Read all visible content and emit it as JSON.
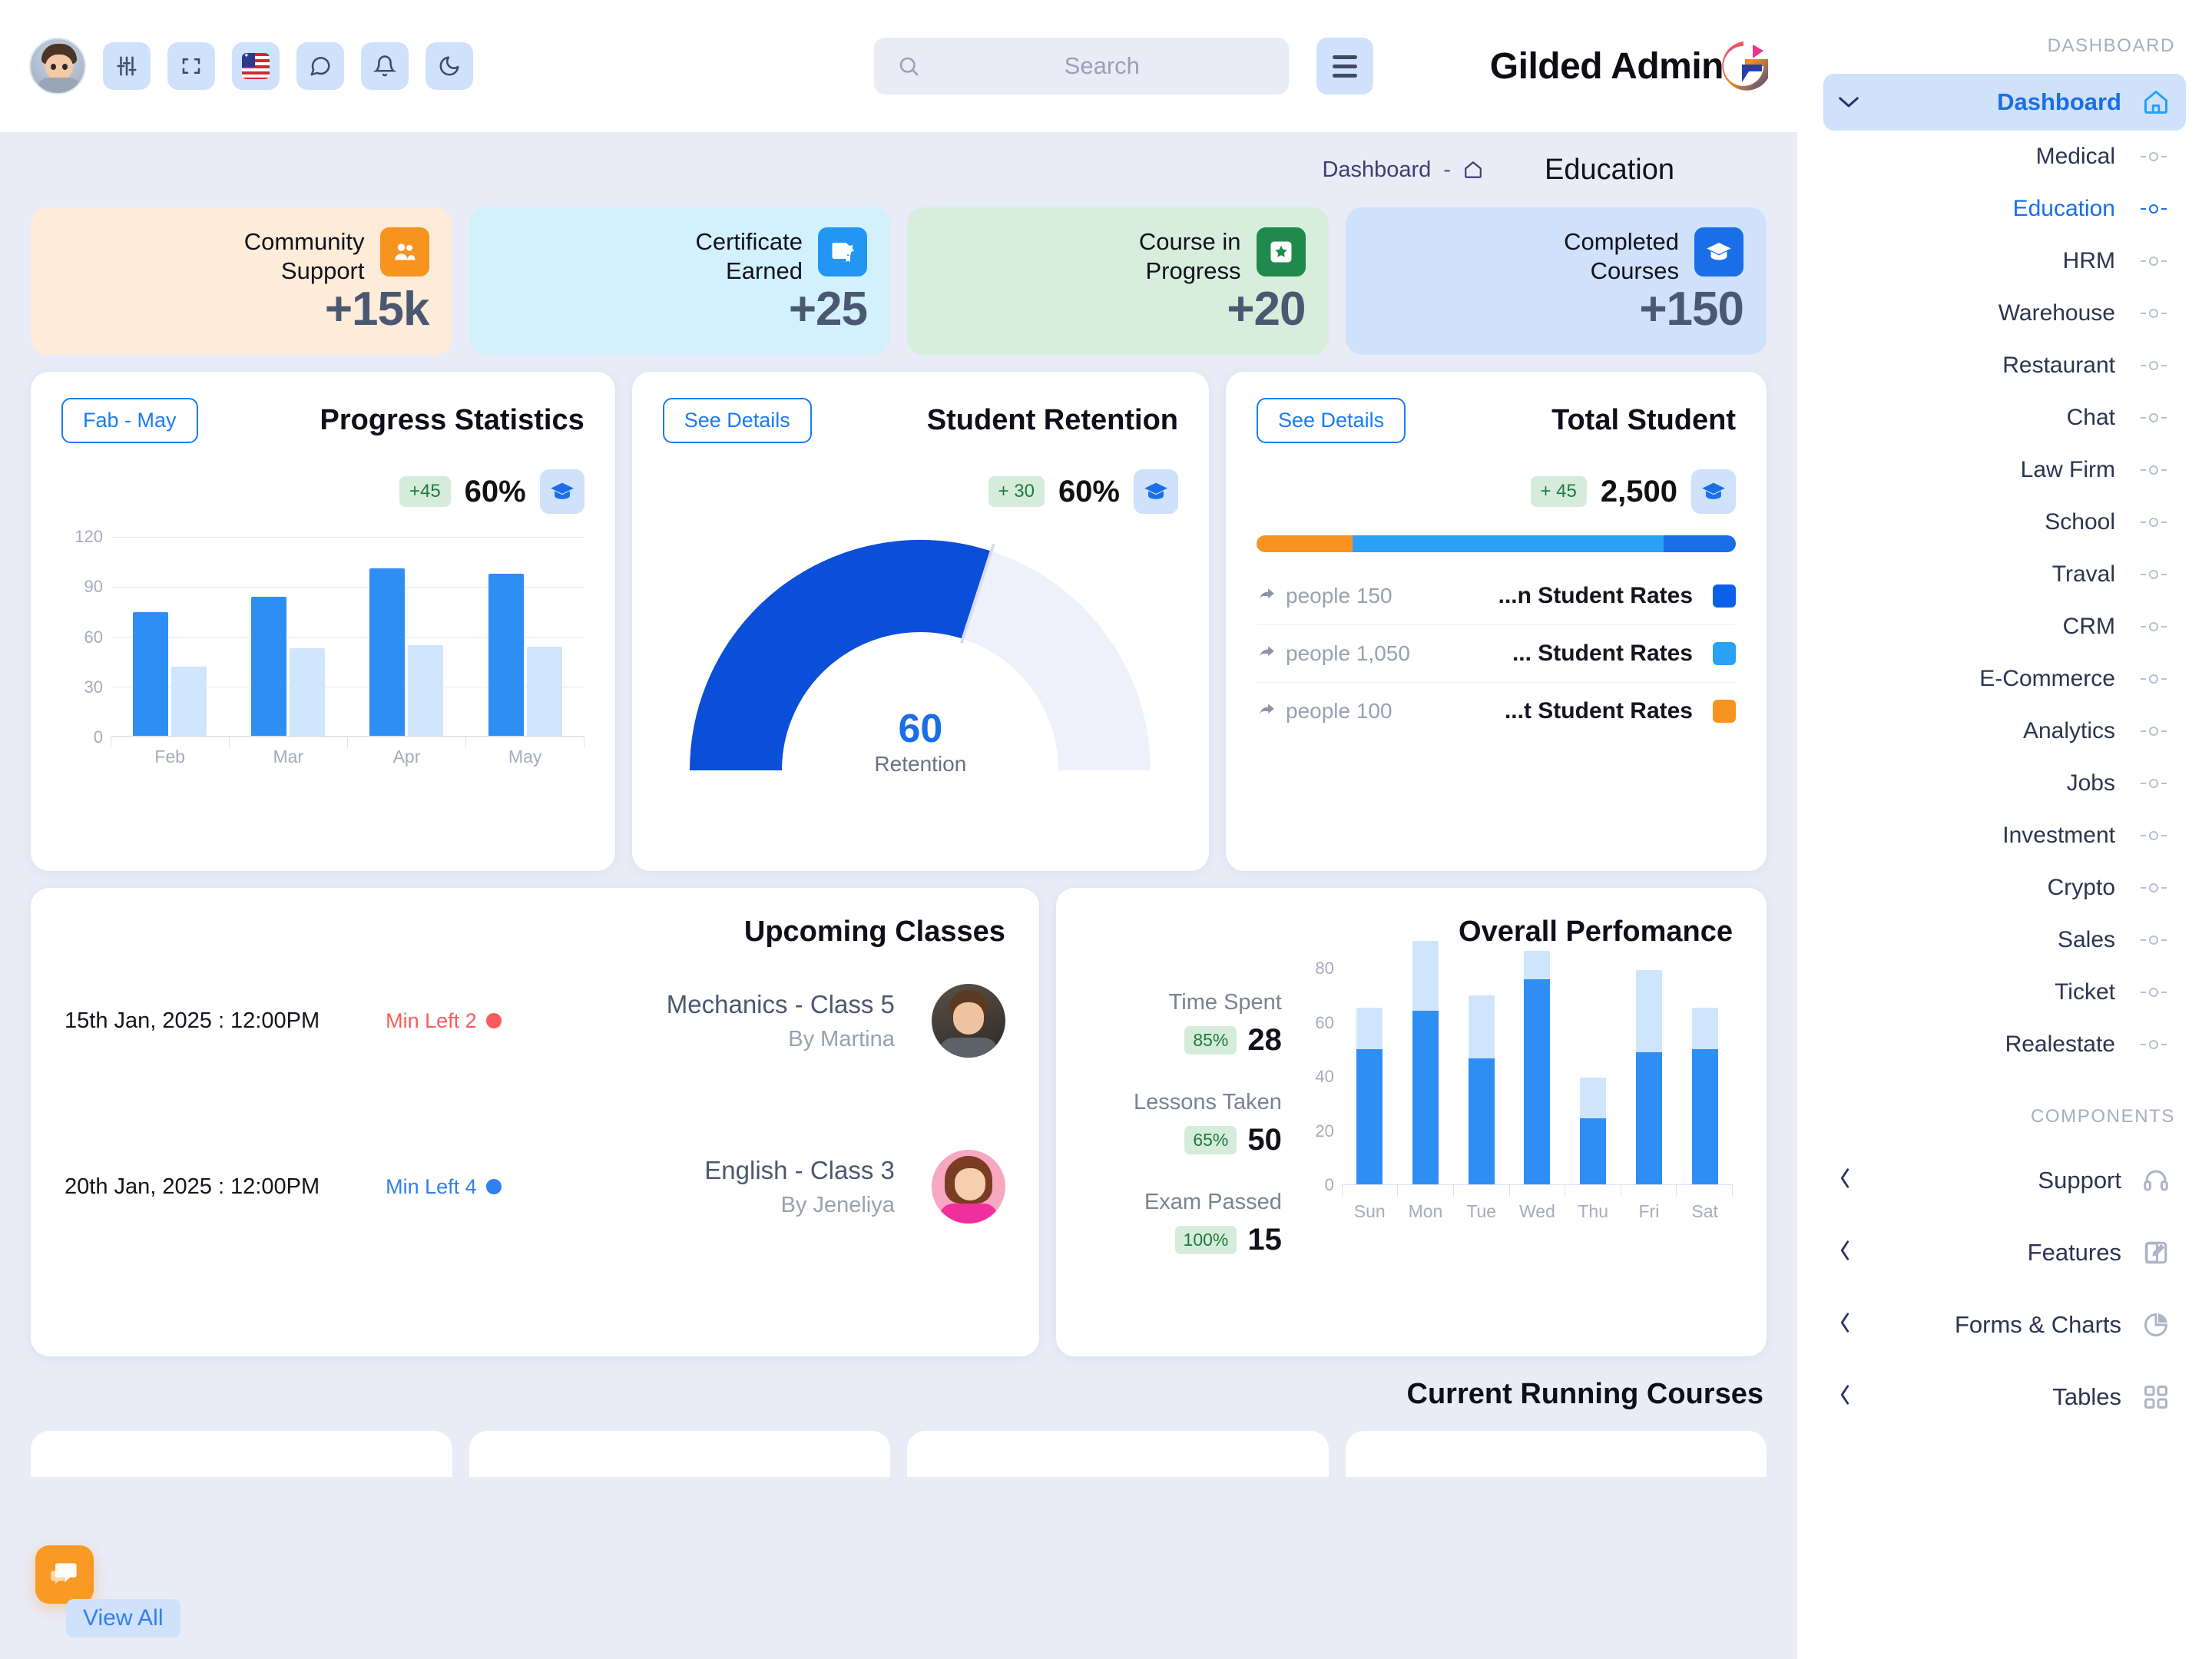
{
  "topbar": {
    "avatar_name": "user-avatar",
    "icons": [
      "sliders-icon",
      "fullscreen-icon",
      "flag-us-icon",
      "chat-icon",
      "bell-icon",
      "moon-icon"
    ],
    "search": {
      "placeholder": "Search",
      "value": ""
    },
    "menu_label": "menu-icon",
    "brand": "Gilded Admin"
  },
  "breadcrumb": {
    "root": "Dashboard",
    "sep": "-",
    "home_icon": "home-icon"
  },
  "page_title": "Education",
  "stats": [
    {
      "label": "Community\nSupport",
      "label_l1": "Community",
      "label_l2": "Support",
      "value": "+15k",
      "icon": "people-icon",
      "bg": "#fdecd8",
      "icon_bg": "#f7941f",
      "bar": "#f7941f"
    },
    {
      "label_l1": "Certificate",
      "label_l2": "Earned",
      "value": "+25",
      "icon": "certificate-icon",
      "bg": "#d3f1fd",
      "icon_bg": "#2196f3",
      "bar": "#13bdf5"
    },
    {
      "label_l1": "Course in",
      "label_l2": "Progress",
      "value": "+20",
      "icon": "star-badge-icon",
      "bg": "#d7eedd",
      "icon_bg": "#1f8a4c",
      "bar": "#1f8a4c"
    },
    {
      "label_l1": "Completed",
      "label_l2": "Courses",
      "value": "+150",
      "icon": "graduation-cap-icon",
      "bg": "#cfe1fb",
      "icon_bg": "#1a6fe8",
      "bar": "#1a4fd8"
    }
  ],
  "progress_statistics": {
    "button": "Fab - May",
    "title": "Progress Statistics",
    "chip": "+45",
    "metric": "60%",
    "icon": "graduation-cap-icon"
  },
  "student_retention": {
    "button": "See Details",
    "title": "Student Retention",
    "chip": "+ 30",
    "metric": "60%",
    "icon": "graduation-cap-icon",
    "gauge_value": "60",
    "gauge_label": "Retention"
  },
  "total_student": {
    "button": "See Details",
    "title": "Total Student",
    "chip": "+ 45",
    "metric": "2,500",
    "icon": "graduation-cap-icon",
    "segments": [
      {
        "color": "#f7941f",
        "pct": 20
      },
      {
        "color": "#2aa0f7",
        "pct": 65
      },
      {
        "color": "#1a6fe8",
        "pct": 15
      }
    ],
    "rows": [
      {
        "people": "people 150",
        "name": "...n Student Rates",
        "color": "#0b5fe8"
      },
      {
        "people": "people 1,050",
        "name": "... Student Rates",
        "color": "#2aa0f7"
      },
      {
        "people": "people 100",
        "name": "...t Student Rates",
        "color": "#f7941f"
      }
    ]
  },
  "upcoming_classes": {
    "title": "Upcoming Classes",
    "items": [
      {
        "date": "15th Jan, 2025 : 12:00PM",
        "min_left": "Min Left 2",
        "min_color": "#fa5b5b",
        "name": "Mechanics - Class 5",
        "by": "By Martina",
        "avatar": "instructor-avatar-martina"
      },
      {
        "date": "20th Jan, 2025 : 12:00PM",
        "min_left": "Min Left 4",
        "min_color": "#2f80f0",
        "name": "English - Class 3",
        "by": "By Jeneliya",
        "avatar": "instructor-avatar-jeneliya"
      }
    ]
  },
  "overall_performance": {
    "title": "Overall Perfomance",
    "stats": [
      {
        "label": "Time Spent",
        "chip": "85%",
        "value": "28"
      },
      {
        "label": "Lessons Taken",
        "chip": "65%",
        "value": "50"
      },
      {
        "label": "Exam Passed",
        "chip": "100%",
        "value": "15"
      }
    ]
  },
  "current_running_courses": {
    "title": "Current Running Courses"
  },
  "fab": {
    "icon": "chat-bubbles-icon"
  },
  "view_all": "View All",
  "sidebar": {
    "section_dashboard": "DASHBOARD",
    "dashboard_item": {
      "label": "Dashboard",
      "icon": "home-icon",
      "chevron": "chevron-down-icon"
    },
    "sub_items": [
      {
        "label": "Medical",
        "selected": false
      },
      {
        "label": "Education",
        "selected": true
      },
      {
        "label": "HRM",
        "selected": false
      },
      {
        "label": "Warehouse",
        "selected": false
      },
      {
        "label": "Restaurant",
        "selected": false
      },
      {
        "label": "Chat",
        "selected": false
      },
      {
        "label": "Law Firm",
        "selected": false
      },
      {
        "label": "School",
        "selected": false
      },
      {
        "label": "Traval",
        "selected": false
      },
      {
        "label": "CRM",
        "selected": false
      },
      {
        "label": "E-Commerce",
        "selected": false
      },
      {
        "label": "Analytics",
        "selected": false
      },
      {
        "label": "Jobs",
        "selected": false
      },
      {
        "label": "Investment",
        "selected": false
      },
      {
        "label": "Crypto",
        "selected": false
      },
      {
        "label": "Sales",
        "selected": false
      },
      {
        "label": "Ticket",
        "selected": false
      },
      {
        "label": "Realestate",
        "selected": false
      }
    ],
    "section_components": "COMPONENTS",
    "components": [
      {
        "label": "Support",
        "icon": "headset-icon",
        "chevron": "chevron-left-icon"
      },
      {
        "label": "Features",
        "icon": "edit-square-icon",
        "chevron": "chevron-left-icon"
      },
      {
        "label": "Forms & Charts",
        "icon": "pie-chart-icon",
        "chevron": "chevron-left-icon"
      },
      {
        "label": "Tables",
        "icon": "grid-icon",
        "chevron": "chevron-left-icon"
      }
    ]
  },
  "chart_data": [
    {
      "type": "bar",
      "title": "Progress Statistics",
      "categories": [
        "Feb",
        "Mar",
        "Apr",
        "May"
      ],
      "series": [
        {
          "name": "Primary",
          "color": "#2f8ef4",
          "values": [
            75,
            84,
            101,
            98
          ]
        },
        {
          "name": "Secondary",
          "color": "#cfe5fb",
          "values": [
            42,
            53,
            55,
            54
          ]
        }
      ],
      "ylim": [
        0,
        120
      ],
      "yticks": [
        0,
        30,
        60,
        90,
        120
      ],
      "grid": true,
      "legend": "none"
    },
    {
      "type": "pie",
      "subtype": "gauge",
      "title": "Student Retention",
      "value": 60,
      "max": 100,
      "label": "Retention",
      "colors": {
        "filled": "#0b4fd8",
        "track": "#eef0fb"
      }
    },
    {
      "type": "bar",
      "subtype": "stacked",
      "title": "Overall Perfomance",
      "categories": [
        "Sun",
        "Mon",
        "Tue",
        "Wed",
        "Thu",
        "Fri",
        "Sat"
      ],
      "series": [
        {
          "name": "Lower",
          "color": "#2f8ef4",
          "values": [
            43,
            55,
            40,
            65,
            21,
            42,
            43
          ]
        },
        {
          "name": "Upper",
          "color": "#cfe5fb",
          "values": [
            13,
            22,
            20,
            9,
            13,
            26,
            13
          ]
        }
      ],
      "ylim": [
        0,
        80
      ],
      "yticks": [
        0,
        20,
        40,
        60,
        80
      ],
      "grid": false,
      "legend": "none"
    },
    {
      "type": "bar",
      "subtype": "segmented-progress",
      "title": "Total Student",
      "categories": [
        "Top Student Rates",
        "Mid Student Rates",
        "Lowest Student Rates"
      ],
      "values": [
        150,
        1050,
        100
      ],
      "total": 2500,
      "colors": [
        "#0b5fe8",
        "#2aa0f7",
        "#f7941f"
      ]
    }
  ]
}
